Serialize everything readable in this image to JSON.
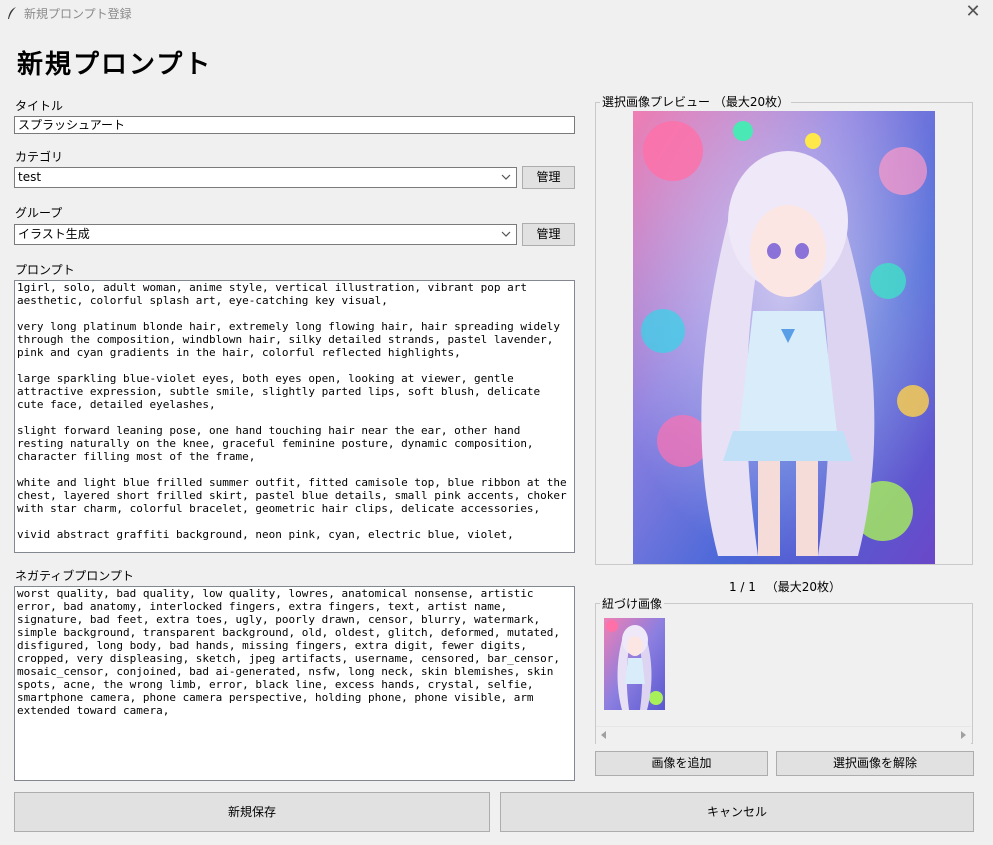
{
  "window": {
    "title": "新規プロンプト登録",
    "close_symbol": "✕"
  },
  "form": {
    "heading": "新規プロンプト",
    "title_label": "タイトル",
    "title_value": "スプラッシュアート",
    "category_label": "カテゴリ",
    "category_value": "test",
    "category_manage": "管理",
    "group_label": "グループ",
    "group_value": "イラスト生成",
    "group_manage": "管理",
    "prompt_label": "プロンプト",
    "prompt_text": "1girl, solo, adult woman, anime style, vertical illustration, vibrant pop art aesthetic, colorful splash art, eye-catching key visual,\n\nvery long platinum blonde hair, extremely long flowing hair, hair spreading widely through the composition, windblown hair, silky detailed strands, pastel lavender, pink and cyan gradients in the hair, colorful reflected highlights,\n\nlarge sparkling blue-violet eyes, both eyes open, looking at viewer, gentle attractive expression, subtle smile, slightly parted lips, soft blush, delicate cute face, detailed eyelashes,\n\nslight forward leaning pose, one hand touching hair near the ear, other hand resting naturally on the knee, graceful feminine posture, dynamic composition, character filling most of the frame,\n\nwhite and light blue frilled summer outfit, fitted camisole top, blue ribbon at the chest, layered short frilled skirt, pastel blue details, small pink accents, choker with star charm, colorful bracelet, geometric hair clips, delicate accessories,\n\nvivid abstract graffiti background, neon pink, cyan, electric blue, violet,",
    "negative_label": "ネガティブプロンプト",
    "negative_text": "worst quality, bad quality, low quality, lowres, anatomical nonsense, artistic error, bad anatomy, interlocked fingers, extra fingers, text, artist name, signature, bad feet, extra toes, ugly, poorly drawn, censor, blurry, watermark, simple background, transparent background, old, oldest, glitch, deformed, mutated, disfigured, long body, bad hands, missing fingers, extra digit, fewer digits, cropped, very displeasing, sketch, jpeg artifacts, username, censored, bar_censor, mosaic_censor, conjoined, bad ai-generated, nsfw, long neck, skin blemishes, skin spots, acne, the wrong limb, error, black line, excess hands, crystal, selfie, smartphone camera, phone camera perspective, holding phone, phone visible, arm extended toward camera,"
  },
  "preview": {
    "frame_title": "選択画像プレビュー （最大20枚）",
    "counter": "1 / 1 　（最大20枚）"
  },
  "linked": {
    "frame_title": "紐づけ画像",
    "add_button": "画像を追加",
    "remove_button": "選択画像を解除"
  },
  "footer": {
    "save_button": "新規保存",
    "cancel_button": "キャンセル"
  },
  "icons": {
    "app": "feather-icon",
    "close": "close-icon",
    "dropdown": "chevron-down-icon",
    "scroll_left": "arrow-left-icon",
    "scroll_right": "arrow-right-icon"
  },
  "colors": {
    "window_bg": "#f0f0f0",
    "button_bg": "#e1e1e1",
    "field_bg": "#ffffff"
  }
}
